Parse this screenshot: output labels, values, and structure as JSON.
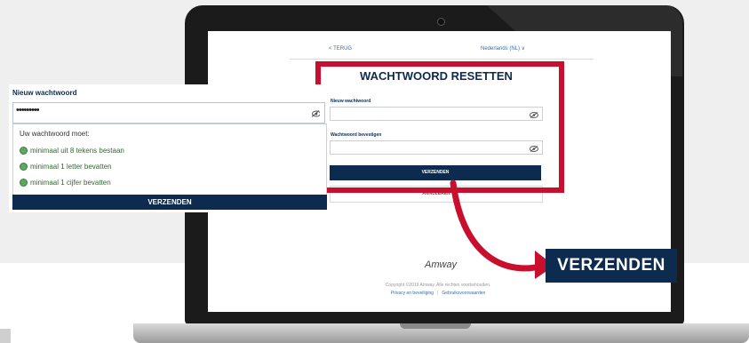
{
  "form": {
    "back": "< TERUG",
    "language": "Nederlands (NL) ∨",
    "title": "WACHTWOORD RESETTEN",
    "new_password_label": "Nieuw wachtwoord",
    "confirm_password_label": "Wachtwoord bevestigen",
    "submit": "VERZENDEN",
    "cancel": "ANNULEREN"
  },
  "footer": {
    "brand": "Amway",
    "copyright": "Copyright ©2019 Amway. Alle rechten voorbehouden.",
    "privacy": "Privacy en beveiliging",
    "terms": "Gebruiksvoorwaarden"
  },
  "zoom": {
    "label": "Nieuw wachtwoord",
    "value": "•••••••••",
    "requirements_title": "Uw wachtwoord moet:",
    "requirements": [
      "minimaal uit 8 tekens bestaan",
      "minimaal 1 letter bevatten",
      "minimaal 1 cijfer bevatten"
    ],
    "submit": "VERZENDEN"
  },
  "callout": {
    "submit": "VERZENDEN"
  },
  "colors": {
    "navy": "#0d2b4e",
    "highlight": "#c8102e",
    "success": "#2e6b31"
  }
}
